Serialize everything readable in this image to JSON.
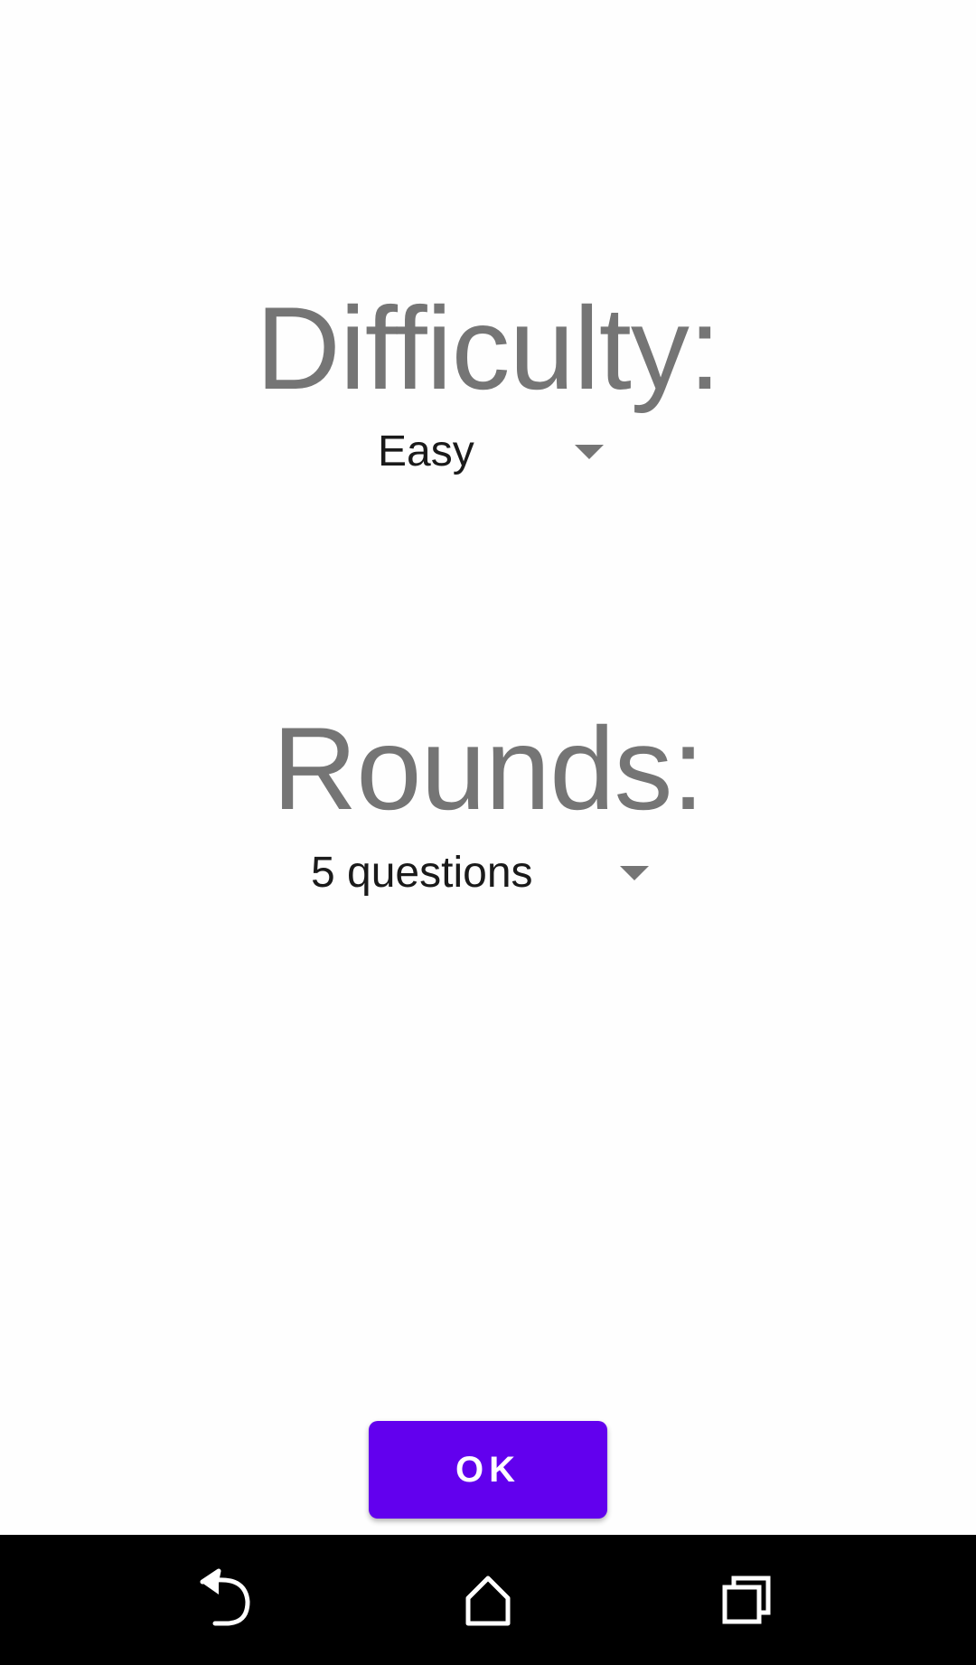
{
  "difficulty": {
    "title": "Difficulty:",
    "selected": "Easy",
    "arrow_icon": "dropdown-arrow-icon"
  },
  "rounds": {
    "title": "Rounds:",
    "selected": "5 questions",
    "arrow_icon": "dropdown-arrow-icon"
  },
  "ok_button": {
    "label": "OK",
    "color": "#6200ee"
  },
  "colors": {
    "title_text": "#757575",
    "value_text": "#1a1a1a",
    "nav_bar": "#000000"
  },
  "nav_bar": {
    "back_icon": "back-icon",
    "home_icon": "home-icon",
    "recents_icon": "recents-icon"
  }
}
